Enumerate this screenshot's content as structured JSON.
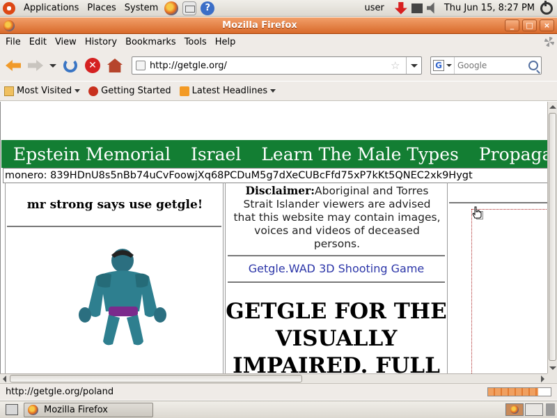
{
  "top_panel": {
    "menus": [
      "Applications",
      "Places",
      "System"
    ],
    "launchers": [
      "firefox-icon",
      "mail-icon",
      "help-icon"
    ],
    "help_glyph": "?",
    "user": "user",
    "tray_icons": [
      "update-notifier-icon",
      "network-icon",
      "volume-icon",
      "power-icon"
    ],
    "clock": "Thu Jun 15,  8:27 PM"
  },
  "window": {
    "title": "Mozilla Firefox",
    "buttons": {
      "minimize": "_",
      "maximize": "□",
      "close": "×"
    }
  },
  "menu_bar": [
    "File",
    "Edit",
    "View",
    "History",
    "Bookmarks",
    "Tools",
    "Help"
  ],
  "nav": {
    "url": "http://getgle.org/",
    "search_placeholder": "Google",
    "stop_glyph": "✕",
    "star_glyph": "☆",
    "google_glyph": "G"
  },
  "bookmarks": [
    {
      "label": "Most Visited",
      "dropdown": true
    },
    {
      "label": "Getting Started",
      "dropdown": false
    },
    {
      "label": "Latest Headlines",
      "dropdown": true
    }
  ],
  "page": {
    "banner_links": [
      "Epstein Memorial",
      "Israel",
      "Learn The Male Types",
      "Propaganda"
    ],
    "monero": "monero: 839HDnU8s5nBb74uCvFoowjXq68PCDuM5g7dXeCUBcFfd75xP7kKt5QNEC2xk9Hygt",
    "mr_strong": "mr strong says use getgle!",
    "disclaimer_label": "Disclaimer:",
    "disclaimer_text": "Aboriginal and Torres Strait Islander viewers are advised that this website may contain images, voices and videos of deceased persons.",
    "wad_link": "Getgle.WAD 3D Shooting Game",
    "visually_impaired": "GETGLE FOR THE VISUALLY IMPAIRED. FULL"
  },
  "status": {
    "text": "http://getgle.org/poland",
    "progress": 0.8
  },
  "taskbar": {
    "item": "Mozilla Firefox"
  },
  "colors": {
    "banner": "#137e33",
    "link": "#2b35a8",
    "titlebar": "#d8692a"
  }
}
